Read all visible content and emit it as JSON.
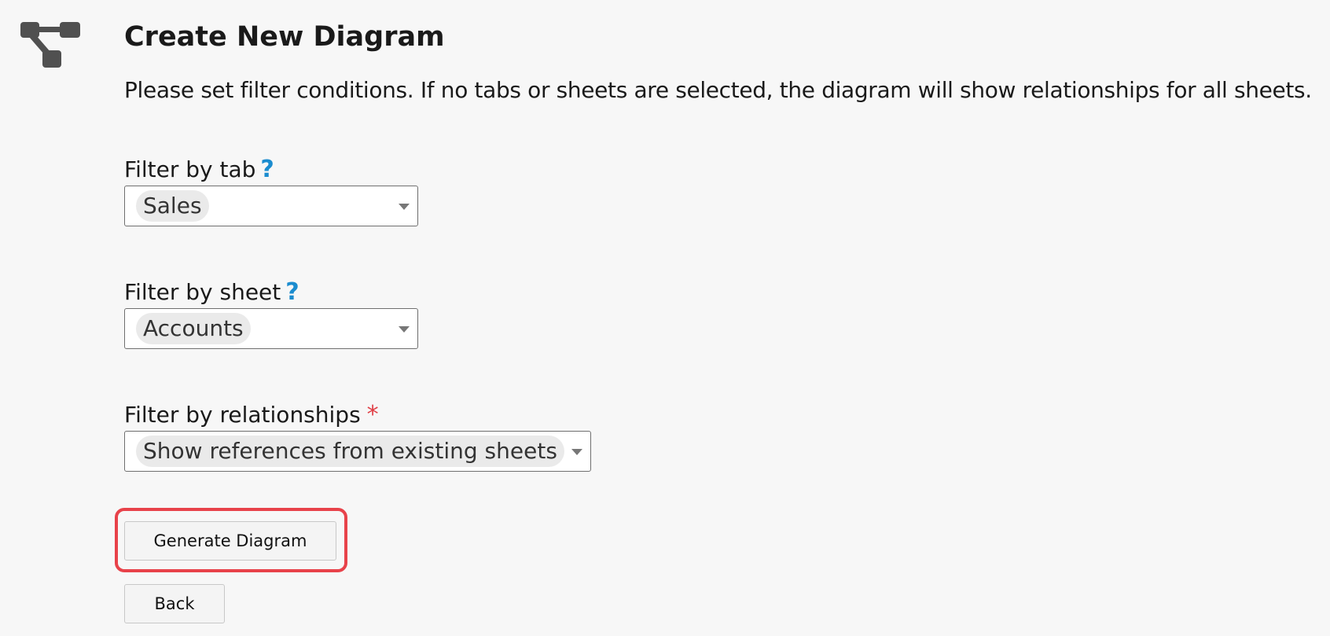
{
  "header": {
    "icon": "diagram-icon",
    "title": "Create New Diagram",
    "description": "Please set filter conditions. If no tabs or sheets are selected, the diagram will show relationships for all sheets."
  },
  "filters": {
    "tab": {
      "label": "Filter by tab",
      "help": "?",
      "value": "Sales"
    },
    "sheet": {
      "label": "Filter by sheet",
      "help": "?",
      "value": "Accounts"
    },
    "relationships": {
      "label": "Filter by relationships",
      "required": "*",
      "value": "Show references from existing sheets"
    }
  },
  "actions": {
    "generate_label": "Generate Diagram",
    "back_label": "Back"
  },
  "colors": {
    "background": "#f7f7f7",
    "help": "#1b8ccf",
    "required": "#e03e45",
    "highlight": "#e8424a",
    "icon": "#505050"
  }
}
